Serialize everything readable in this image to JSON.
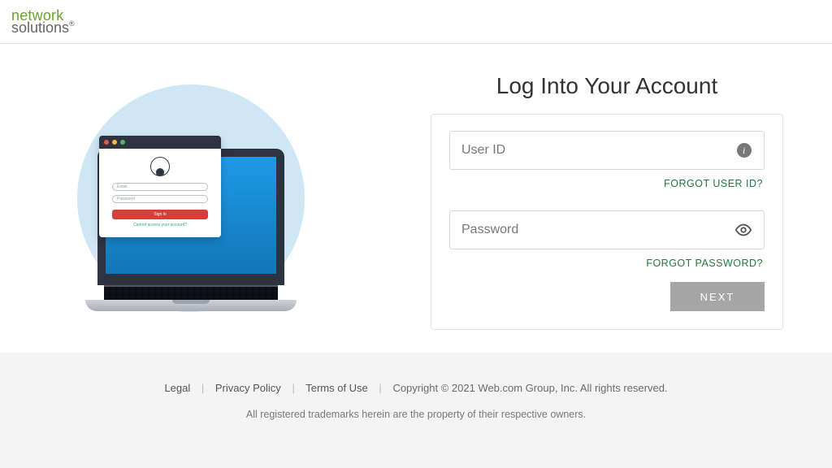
{
  "brand": {
    "line1": "network",
    "line2": "solutions"
  },
  "login": {
    "title": "Log Into Your Account",
    "user_id_placeholder": "User ID",
    "user_id_value": "",
    "forgot_user_id": "FORGOT USER ID?",
    "password_placeholder": "Password",
    "password_value": "",
    "forgot_password": "FORGOT PASSWORD?",
    "next_label": "NEXT"
  },
  "illustration": {
    "field1_label": "Email",
    "field2_label": "Password",
    "button_label": "Sign in",
    "link_label": "Cannot access your account?"
  },
  "footer": {
    "legal": "Legal",
    "privacy": "Privacy Policy",
    "terms": "Terms of Use",
    "copyright": "Copyright © 2021 Web.com Group, Inc. All rights reserved.",
    "trademark": "All registered trademarks herein are the property of their respective owners."
  }
}
